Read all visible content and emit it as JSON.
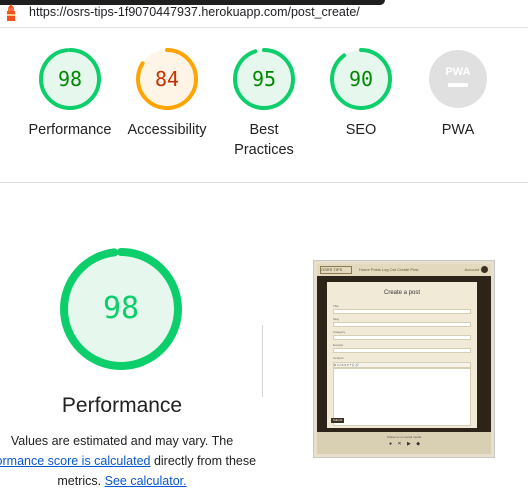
{
  "browser": {
    "url": "https://osrs-tips-1f9070447937.herokuapp.com/post_create/"
  },
  "summary": [
    {
      "label": "Performance",
      "score": "98",
      "status": "pass",
      "color": "#0cce6b",
      "fill": "#e6f8ee",
      "text_color": "#008800",
      "fraction": 0.98
    },
    {
      "label": "Accessibility",
      "score": "84",
      "status": "average",
      "color": "#ffa400",
      "fill": "#fff5e6",
      "text_color": "#c33300",
      "fraction": 0.84
    },
    {
      "label": "Best Practices",
      "score": "95",
      "status": "pass",
      "color": "#0cce6b",
      "fill": "#e6f8ee",
      "text_color": "#008800",
      "fraction": 0.95
    },
    {
      "label": "SEO",
      "score": "90",
      "status": "pass",
      "color": "#0cce6b",
      "fill": "#e6f8ee",
      "text_color": "#008800",
      "fraction": 0.9
    },
    {
      "label": "PWA",
      "score": "",
      "status": "na",
      "color": "#cccccc",
      "fill": "#e0e0e0",
      "text_color": "#ffffff",
      "icon": "pwa-icon",
      "badge_text": "PWA"
    }
  ],
  "performance": {
    "title": "Performance",
    "score": "98",
    "fraction": 0.98,
    "color": "#0cce6b",
    "note_line1": "Values are estimated and may vary. The",
    "note_link1": "rformance score is calculated",
    "note_mid": " directly from these",
    "note_prefix2": "metrics. ",
    "note_link2": "See calculator."
  },
  "thumbnail": {
    "brand": "OSRS TIPS",
    "nav_links": "Home   Posts   Log Out   Create Post",
    "account": "Account",
    "card_title": "Create a post",
    "label_title": "Title",
    "label_slug": "Slug",
    "label_category": "Category",
    "label_excerpt": "Excerpt",
    "label_content": "Content",
    "toolbar": "B  I  U  S   ≡  ≡   ❝  ⟨⟩  🔗",
    "submit": "Submit",
    "footer_text": "Follow us on social media",
    "footer_icons": "● ✕ ▶ ◆"
  }
}
